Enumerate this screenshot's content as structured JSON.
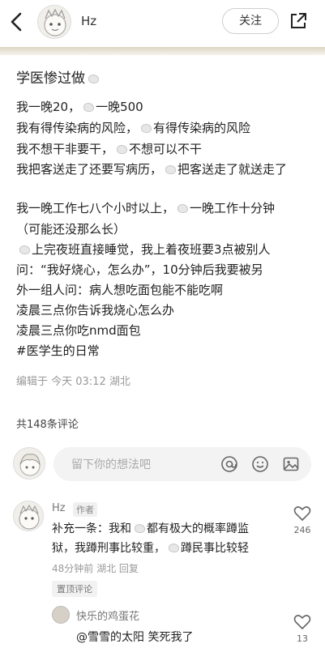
{
  "header": {
    "author_name": "Hz",
    "follow_label": "关注"
  },
  "post": {
    "title": "学医惨过做",
    "lines": [
      {
        "a": "我一晚20，",
        "b": "一晚500"
      },
      {
        "a": "我有得传染病的风险，",
        "b": "有得传染病的风险"
      },
      {
        "a": "我不想干非要干，",
        "b": "不想可以不干"
      },
      {
        "a": "我把客送走了还要写病历，",
        "b": "把客送走了就送走了"
      },
      {
        "a": "我一晚工作七八个小时以上，",
        "b": "一晚工作十分钟"
      },
      {
        "a": "（可能还没那么长）"
      },
      {
        "a": "上完夜班直接睡觉，我上着夜班要3点被别人"
      },
      {
        "a": "问：“我好烧心，怎么办”，10分钟后我要被另"
      },
      {
        "a": "外一组人问：病人想吃面包能不能吃啊"
      },
      {
        "a": "凌晨三点你告诉我烧心怎么办"
      },
      {
        "a": "凌晨三点你吃nmd面包"
      },
      {
        "a": "#医学生的日常"
      }
    ],
    "edit_meta": "编辑于 今天 03:12 湖北",
    "comment_count": "共148条评论"
  },
  "comment_input": {
    "placeholder": "留下你的想法吧",
    "icons": [
      "at-icon",
      "smiley-icon",
      "image-icon"
    ]
  },
  "comments": [
    {
      "name": "Hz",
      "tag": "作者",
      "line1_a": "补充一条：我和",
      "line1_b": "都有极大的概率蹲监",
      "line2_a": "狱，我蹲刑事比较重，",
      "line2_b": "蹲民事比较轻",
      "meta": "48分钟前 湖北 回复",
      "pin": "置顶评论",
      "likes": "246"
    }
  ],
  "reply": {
    "name": "快乐的鸡蛋花",
    "text": "@雪雪的太阳 笑死我了",
    "likes": "13"
  }
}
